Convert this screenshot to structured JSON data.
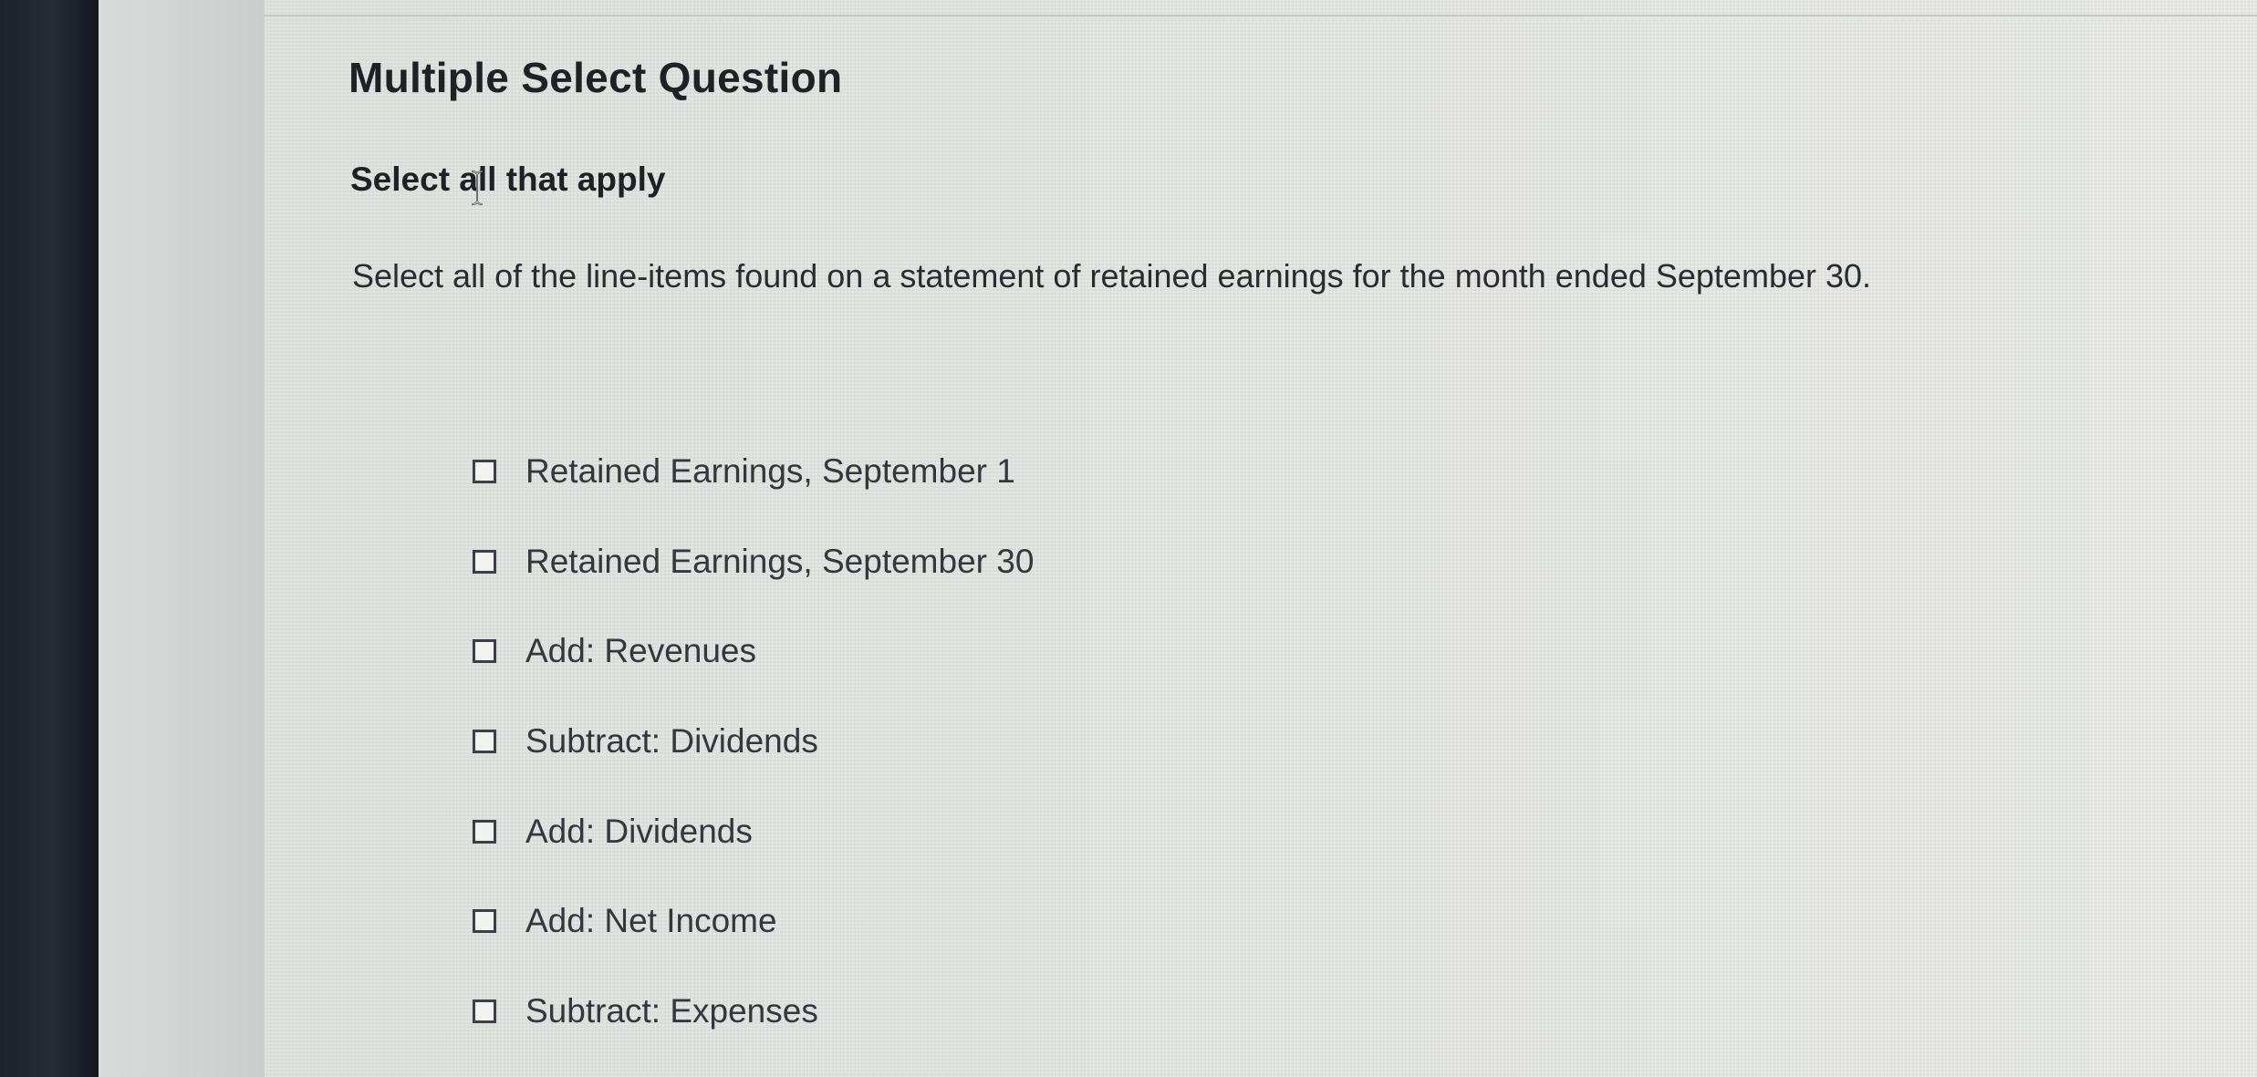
{
  "question": {
    "title": "Multiple Select Question",
    "subtitle": "Select all that apply",
    "prompt": "Select all of the line-items found on a statement of retained earnings for the month ended September 30."
  },
  "options": [
    {
      "label": "Retained Earnings, September 1",
      "checked": false
    },
    {
      "label": "Retained Earnings, September 30",
      "checked": false
    },
    {
      "label": "Add: Revenues",
      "checked": false
    },
    {
      "label": "Subtract: Dividends",
      "checked": false
    },
    {
      "label": "Add: Dividends",
      "checked": false
    },
    {
      "label": "Add: Net Income",
      "checked": false
    },
    {
      "label": "Subtract: Expenses",
      "checked": false
    }
  ],
  "icons": {
    "checkbox": "checkbox-icon",
    "cursor": "text-cursor-icon"
  },
  "colors": {
    "text": "#1f2124",
    "checkbox_border": "#3c3f44"
  }
}
